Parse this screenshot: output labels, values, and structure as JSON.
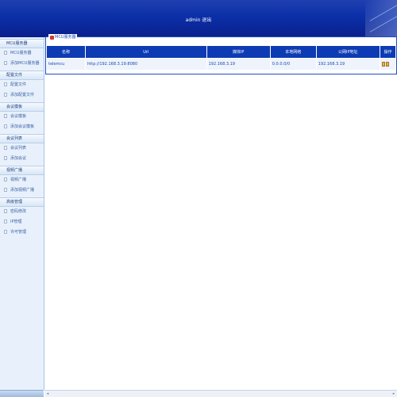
{
  "header": {
    "title": "admin 退出"
  },
  "sidebar": {
    "sections": [
      {
        "title": "MCU服务器",
        "items": [
          "MCU服务器",
          "添加MCU服务器"
        ]
      },
      {
        "title": "配置文件",
        "items": [
          "配置文件",
          "添加配置文件"
        ]
      },
      {
        "title": "会议模板",
        "items": [
          "会议模板",
          "添加会议模板"
        ]
      },
      {
        "title": "会议列表",
        "items": [
          "会议列表",
          "添加会议"
        ]
      },
      {
        "title": "视频广播",
        "items": [
          "视频广播",
          "添加视频广播"
        ]
      },
      {
        "title": "高级管理",
        "items": [
          "密码修改",
          "IP管理",
          "许可管理"
        ]
      }
    ]
  },
  "main": {
    "legend": "MCU服务器",
    "table": {
      "headers": [
        "名称",
        "Url",
        "媒体IP",
        "本地网络",
        "公网IP地址",
        "操作"
      ],
      "rows": [
        [
          "telemcu",
          "http://192.168.3.19:8080",
          "192.168.3.19",
          "0.0.0.0/0",
          "192.168.3.19",
          ""
        ]
      ]
    }
  },
  "colors": {
    "header": "#0b2fa8",
    "table_header": "#0d3bb3",
    "sidebar": "#e8f1fb",
    "border": "#1f4ec2"
  }
}
